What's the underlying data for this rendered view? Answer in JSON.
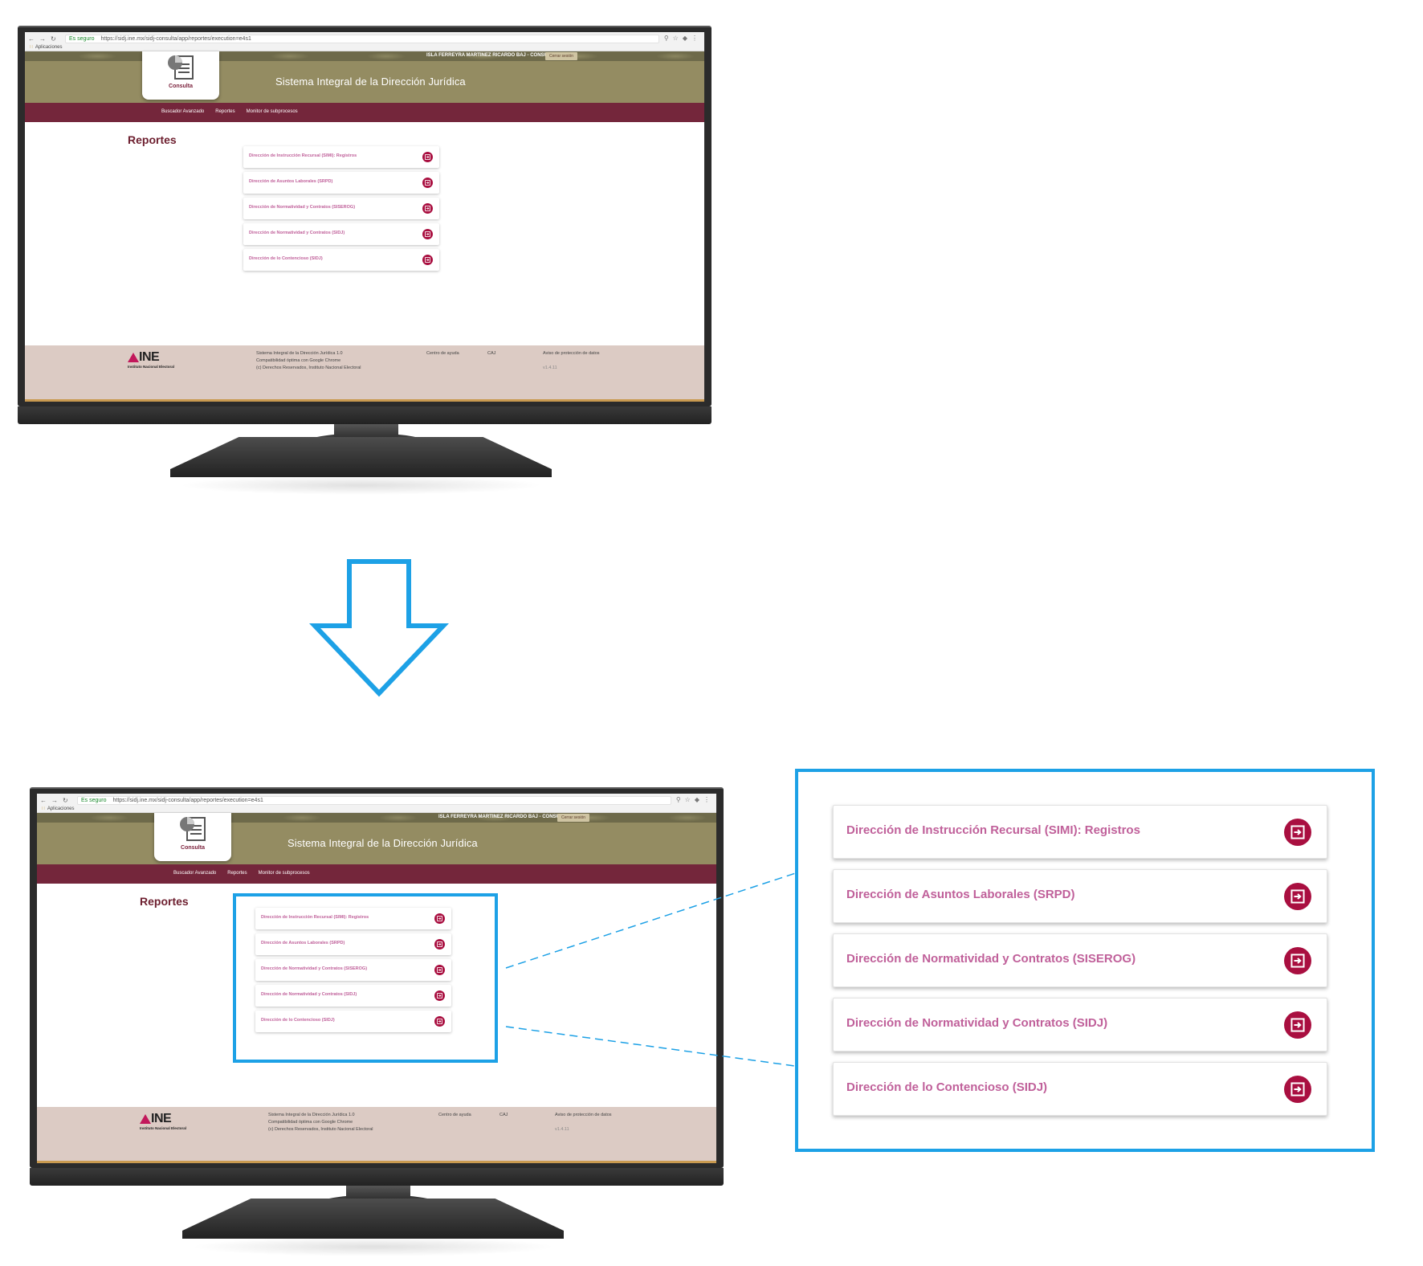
{
  "browser": {
    "secure_label": "Es seguro",
    "url": "https://sidj.ine.mx/sidj-consulta/app/reportes/execution=e4s1",
    "apps_label": "Aplicaciones"
  },
  "site": {
    "user_text": "ISLA FERREYRA MARTINEZ RICARDO  BAJ - CONSULTA SIDJ",
    "close_session": "Cerrar sesión",
    "logo_label": "Consulta",
    "title": "Sistema Integral de la Dirección Jurídica",
    "nav": [
      "Buscador Avanzado",
      "Reportes",
      "Monitor de subprocesos"
    ],
    "page_title": "Reportes",
    "reports": [
      "Dirección de Instrucción Recursal (SIMI): Registros",
      "Dirección de Asuntos Laborales (SRPD)",
      "Dirección de Normatividad y Contratos (SISEROG)",
      "Dirección de Normatividad y Contratos (SIDJ)",
      "Dirección de lo Contencioso (SIDJ)"
    ],
    "footer": {
      "logo": "INE",
      "logo_sub": "Instituto Nacional Electoral",
      "line1": "Sistema Integral de la Dirección Jurídica 1.0",
      "line2": "Compatibilidad óptima con Google Chrome",
      "line3": "(c) Derechos Reservados, Instituto Nacional Electoral",
      "help": "Centro de ayuda",
      "caj": "CAJ",
      "privacy": "Aviso de protección de datos",
      "version": "v1.4.11"
    }
  },
  "colors": {
    "accent_blue": "#1da1e6",
    "header_olive": "#948c62",
    "nav_maroon": "#74263b",
    "item_text_pink": "#c0609a",
    "icon_red": "#a90f40"
  },
  "icons": {
    "report_item": "exit-arrow-icon",
    "transition": "down-arrow-icon"
  }
}
